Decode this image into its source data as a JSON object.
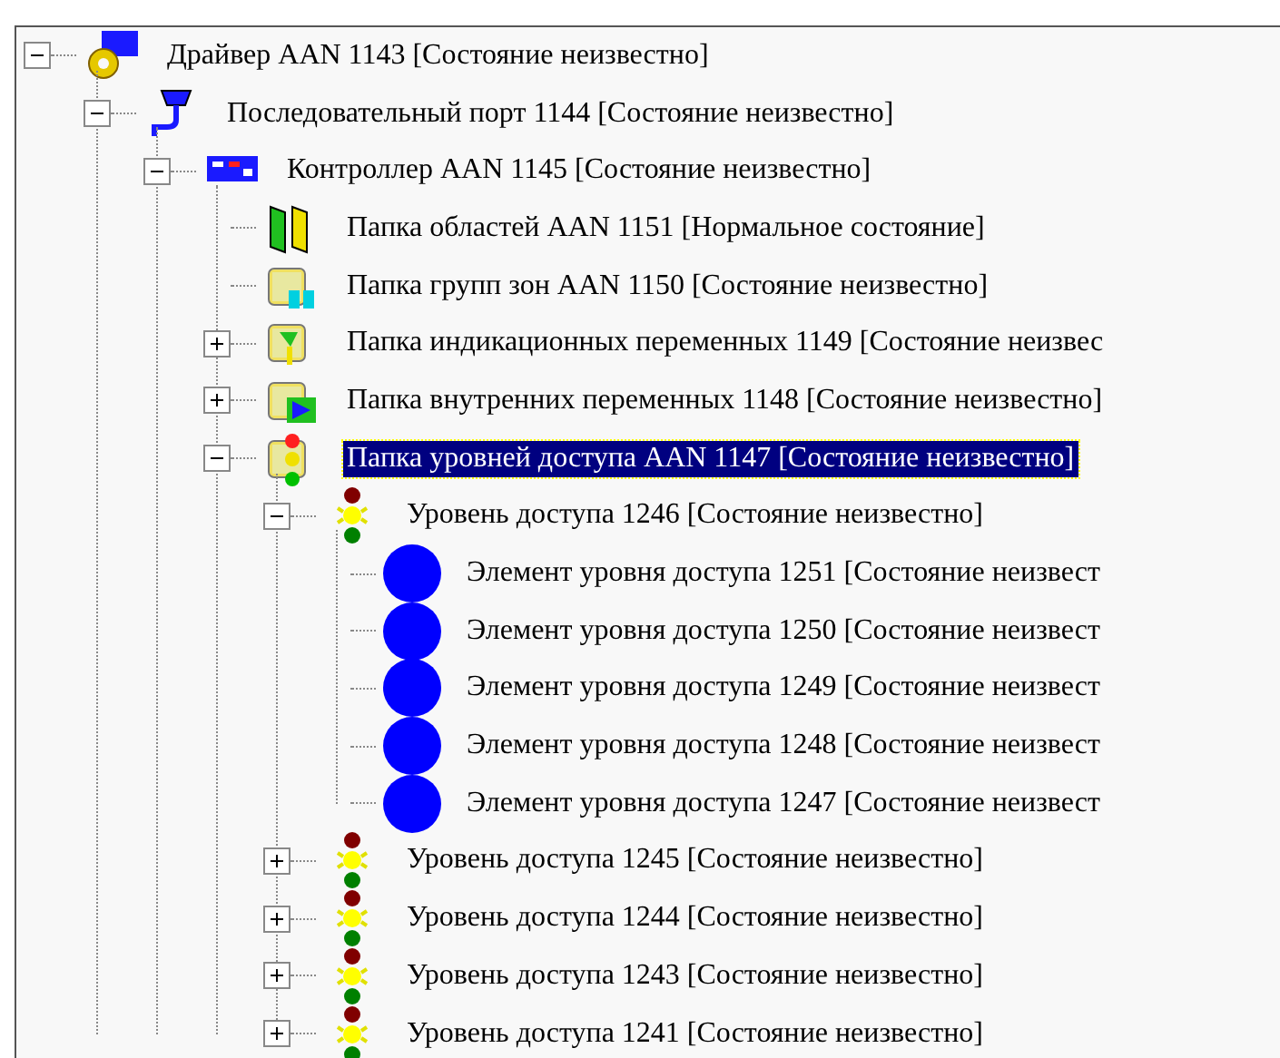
{
  "tree": [
    {
      "kind": "driver",
      "label": "Драйвер AAN 1143 [Состояние неизвестно]",
      "expanded": true,
      "selected": false,
      "children": [
        {
          "kind": "port",
          "label": "Последовательный порт 1144 [Состояние неизвестно]",
          "expanded": true,
          "selected": false,
          "children": [
            {
              "kind": "controller",
              "label": "Контроллер AAN 1145 [Состояние неизвестно]",
              "expanded": true,
              "selected": false,
              "children": [
                {
                  "kind": "areas",
                  "label": "Папка областей AAN 1151 [Нормальное состояние]",
                  "selected": false
                },
                {
                  "kind": "zones",
                  "label": "Папка групп зон AAN 1150 [Состояние неизвестно]",
                  "selected": false
                },
                {
                  "kind": "indicators",
                  "label": "Папка индикационных переменных 1149 [Состояние неизвес",
                  "expanded": false,
                  "selected": false
                },
                {
                  "kind": "internal",
                  "label": "Папка внутренних переменных 1148 [Состояние неизвестно]",
                  "expanded": false,
                  "selected": false
                },
                {
                  "kind": "access-folder",
                  "label": "Папка уровней доступа AAN 1147 [Состояние неизвестно]",
                  "expanded": true,
                  "selected": true,
                  "children": [
                    {
                      "kind": "access-level",
                      "label": "Уровень доступа 1246 [Состояние неизвестно]",
                      "expanded": true,
                      "selected": false,
                      "children": [
                        {
                          "kind": "element",
                          "label": "Элемент уровня доступа 1251 [Состояние неизвест",
                          "selected": false
                        },
                        {
                          "kind": "element",
                          "label": "Элемент уровня доступа 1250 [Состояние неизвест",
                          "selected": false
                        },
                        {
                          "kind": "element",
                          "label": "Элемент уровня доступа 1249 [Состояние неизвест",
                          "selected": false
                        },
                        {
                          "kind": "element",
                          "label": "Элемент уровня доступа 1248 [Состояние неизвест",
                          "selected": false
                        },
                        {
                          "kind": "element",
                          "label": "Элемент уровня доступа 1247 [Состояние неизвест",
                          "selected": false
                        }
                      ]
                    },
                    {
                      "kind": "access-level",
                      "label": "Уровень доступа 1245 [Состояние неизвестно]",
                      "expanded": false,
                      "selected": false
                    },
                    {
                      "kind": "access-level",
                      "label": "Уровень доступа 1244 [Состояние неизвестно]",
                      "expanded": false,
                      "selected": false
                    },
                    {
                      "kind": "access-level",
                      "label": "Уровень доступа 1243 [Состояние неизвестно]",
                      "expanded": false,
                      "selected": false
                    },
                    {
                      "kind": "access-level",
                      "label": "Уровень доступа 1241 [Состояние неизвестно]",
                      "expanded": false,
                      "selected": false
                    }
                  ]
                }
              ]
            }
          ]
        }
      ]
    }
  ]
}
